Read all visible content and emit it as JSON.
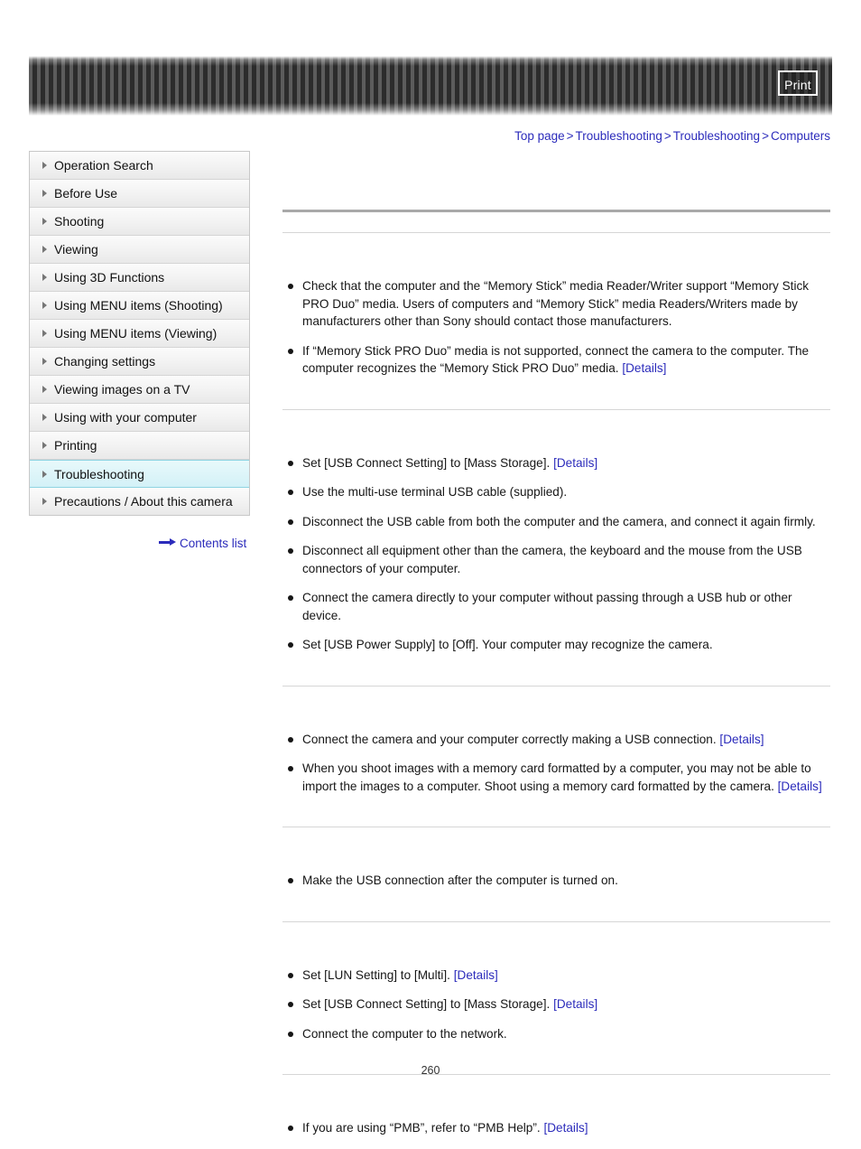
{
  "header": {
    "print_label": "Print",
    "banner_name": "striped-header-banner"
  },
  "breadcrumb": {
    "items": [
      {
        "label": "Top page"
      },
      {
        "label": "Troubleshooting"
      },
      {
        "label": "Troubleshooting"
      },
      {
        "label": "Computers"
      }
    ],
    "separator": ">"
  },
  "sidebar": {
    "items": [
      {
        "label": "Operation Search",
        "active": false
      },
      {
        "label": "Before Use",
        "active": false
      },
      {
        "label": "Shooting",
        "active": false
      },
      {
        "label": "Viewing",
        "active": false
      },
      {
        "label": "Using 3D Functions",
        "active": false
      },
      {
        "label": "Using MENU items (Shooting)",
        "active": false
      },
      {
        "label": "Using MENU items (Viewing)",
        "active": false
      },
      {
        "label": "Changing settings",
        "active": false
      },
      {
        "label": "Viewing images on a TV",
        "active": false
      },
      {
        "label": "Using with your computer",
        "active": false
      },
      {
        "label": "Printing",
        "active": false
      },
      {
        "label": "Troubleshooting",
        "active": true
      },
      {
        "label": "Precautions / About this camera",
        "active": false
      }
    ],
    "contents_list_label": "Contents list"
  },
  "main": {
    "page_title": "",
    "sections": [
      {
        "heading": "",
        "bullets": [
          {
            "text": "Check that the computer and the “Memory Stick” media Reader/Writer support “Memory Stick PRO Duo” media. Users of computers and “Memory Stick” media Readers/Writers made by manufacturers other than Sony should contact those manufacturers.",
            "link": ""
          },
          {
            "text": "If “Memory Stick PRO Duo” media is not supported, connect the camera to the computer. The computer recognizes the “Memory Stick PRO Duo” media. ",
            "link": "[Details]"
          }
        ]
      },
      {
        "heading": "",
        "bullets": [
          {
            "text": "Set [USB Connect Setting] to [Mass Storage]. ",
            "link": "[Details]"
          },
          {
            "text": "Use the multi-use terminal USB cable (supplied).",
            "link": ""
          },
          {
            "text": "Disconnect the USB cable from both the computer and the camera, and connect it again firmly.",
            "link": ""
          },
          {
            "text": "Disconnect all equipment other than the camera, the keyboard and the mouse from the USB connectors of your computer.",
            "link": ""
          },
          {
            "text": "Connect the camera directly to your computer without passing through a USB hub or other device.",
            "link": ""
          },
          {
            "text": "Set [USB Power Supply] to [Off]. Your computer may recognize the camera.",
            "link": ""
          }
        ]
      },
      {
        "heading": "",
        "bullets": [
          {
            "text": "Connect the camera and your computer correctly making a USB connection. ",
            "link": "[Details]"
          },
          {
            "text": "When you shoot images with a memory card formatted by a computer, you may not be able to import the images to a computer. Shoot using a memory card formatted by the camera. ",
            "link": "[Details]"
          }
        ]
      },
      {
        "heading": "",
        "bullets": [
          {
            "text": "Make the USB connection after the computer is turned on.",
            "link": ""
          }
        ]
      },
      {
        "heading": "",
        "bullets": [
          {
            "text": "Set [LUN Setting] to [Multi]. ",
            "link": "[Details]"
          },
          {
            "text": "Set [USB Connect Setting] to [Mass Storage]. ",
            "link": "[Details]"
          },
          {
            "text": "Connect the computer to the network.",
            "link": ""
          }
        ]
      },
      {
        "heading": "",
        "bullets": [
          {
            "text": "If you are using “PMB”, refer to “PMB Help”. ",
            "link": "[Details]"
          }
        ]
      }
    ]
  },
  "footer": {
    "page_number": "260"
  }
}
